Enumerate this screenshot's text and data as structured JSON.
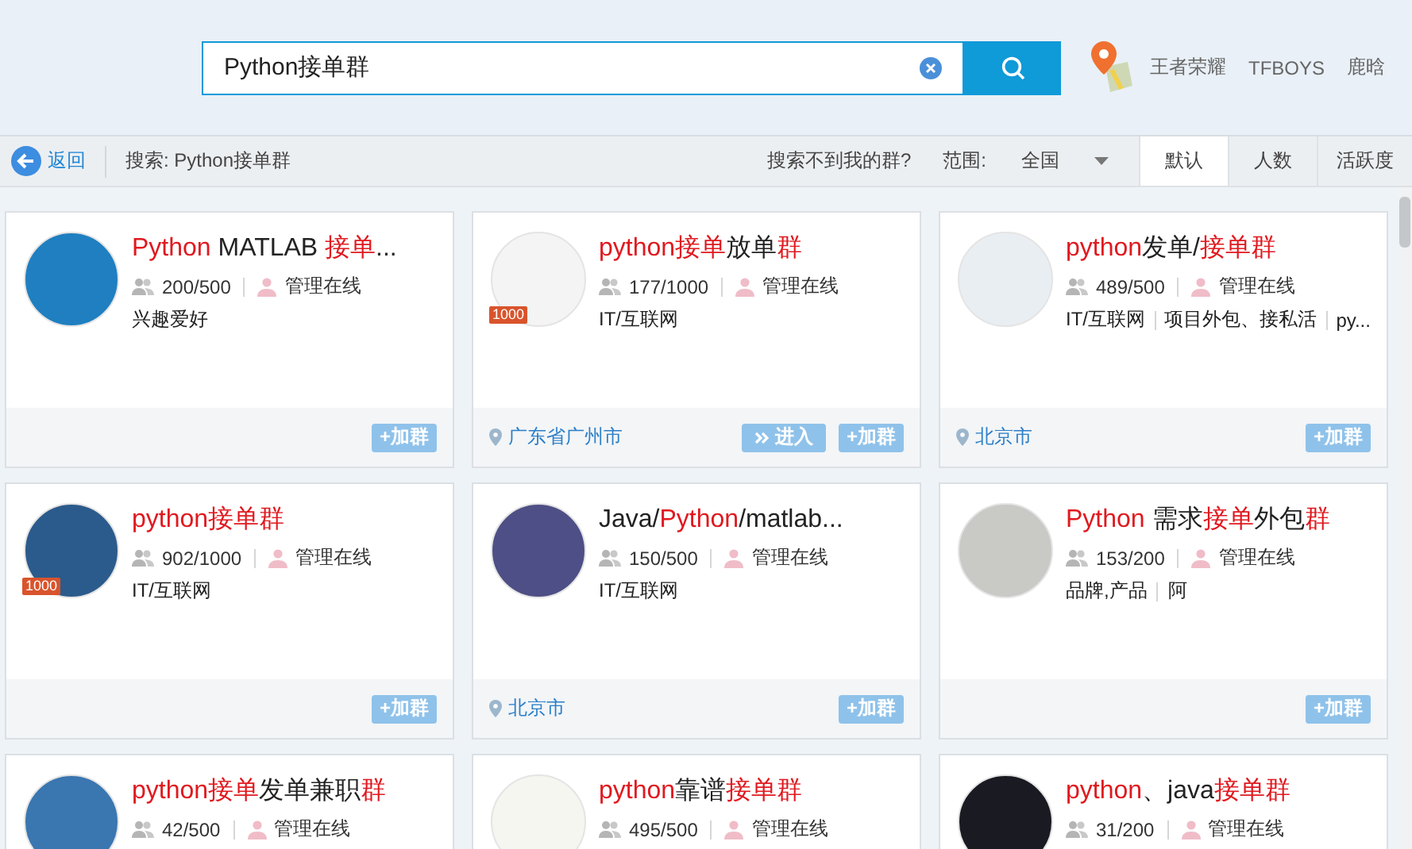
{
  "search": {
    "value": "Python接单群"
  },
  "top_links": [
    "王者荣耀",
    "TFBOYS",
    "鹿晗"
  ],
  "toolbar": {
    "back": "返回",
    "query": "搜索: Python接单群",
    "help": "搜索不到我的群?",
    "range_label": "范围:",
    "range_value": "全国",
    "sort_tabs": [
      {
        "label": "默认",
        "selected": true
      },
      {
        "label": "人数",
        "selected": false
      },
      {
        "label": "活跃度",
        "selected": false
      }
    ]
  },
  "groups": [
    {
      "title": [
        {
          "text": "Python",
          "highlight": true
        },
        {
          "text": " MATLAB ",
          "highlight": false
        },
        {
          "text": "接单",
          "highlight": true
        },
        {
          "text": "...",
          "highlight": false
        }
      ],
      "avatar": {
        "color": "#1f7fc0"
      },
      "members": "200/500",
      "admin": "管理在线",
      "tags": [
        "兴趣爱好"
      ],
      "buttons": [
        {
          "kind": "join",
          "label": "+加群"
        }
      ]
    },
    {
      "title": [
        {
          "text": "python接单",
          "highlight": true
        },
        {
          "text": "放单",
          "highlight": false
        },
        {
          "text": "群",
          "highlight": true
        }
      ],
      "avatar": {
        "color": "#f4f4f4",
        "badge": "1000"
      },
      "members": "177/1000",
      "admin": "管理在线",
      "tags": [
        "IT/互联网"
      ],
      "location": "广东省广州市",
      "buttons": [
        {
          "kind": "enter",
          "label": "进入"
        },
        {
          "kind": "join",
          "label": "+加群"
        }
      ]
    },
    {
      "title": [
        {
          "text": "python",
          "highlight": true
        },
        {
          "text": "发单/",
          "highlight": false
        },
        {
          "text": "接单群",
          "highlight": true
        }
      ],
      "avatar": {
        "color": "#e9eef3"
      },
      "members": "489/500",
      "admin": "管理在线",
      "tags": [
        "IT/互联网",
        "项目外包、接私活",
        "py..."
      ],
      "location": "北京市",
      "buttons": [
        {
          "kind": "join",
          "label": "+加群"
        }
      ]
    },
    {
      "title": [
        {
          "text": "python接单群",
          "highlight": true
        }
      ],
      "avatar": {
        "color": "#2b5b8c",
        "badge": "1000"
      },
      "members": "902/1000",
      "admin": "管理在线",
      "tags": [
        "IT/互联网"
      ],
      "buttons": [
        {
          "kind": "join",
          "label": "+加群"
        }
      ]
    },
    {
      "title": [
        {
          "text": "Java/",
          "highlight": false
        },
        {
          "text": "Python",
          "highlight": true
        },
        {
          "text": "/matlab...",
          "highlight": false
        }
      ],
      "avatar": {
        "color": "#4e4f86"
      },
      "members": "150/500",
      "admin": "管理在线",
      "tags": [
        "IT/互联网"
      ],
      "location": "北京市",
      "buttons": [
        {
          "kind": "join",
          "label": "+加群"
        }
      ]
    },
    {
      "title": [
        {
          "text": "Python",
          "highlight": true
        },
        {
          "text": " 需求",
          "highlight": false
        },
        {
          "text": "接单",
          "highlight": true
        },
        {
          "text": "外包",
          "highlight": false
        },
        {
          "text": "群",
          "highlight": true
        }
      ],
      "avatar": {
        "color": "#c9cac6"
      },
      "members": "153/200",
      "admin": "管理在线",
      "tags": [
        "品牌,产品",
        "阿"
      ],
      "buttons": [
        {
          "kind": "join",
          "label": "+加群"
        }
      ]
    },
    {
      "title": [
        {
          "text": "python接单",
          "highlight": true
        },
        {
          "text": "发单兼职",
          "highlight": false
        },
        {
          "text": "群",
          "highlight": true
        }
      ],
      "avatar": {
        "color": "#3a76b0"
      },
      "members": "42/500",
      "admin": "管理在线"
    },
    {
      "title": [
        {
          "text": "python",
          "highlight": true
        },
        {
          "text": "靠谱",
          "highlight": false
        },
        {
          "text": "接单群",
          "highlight": true
        }
      ],
      "avatar": {
        "color": "#f6f6f0"
      },
      "members": "495/500",
      "admin": "管理在线"
    },
    {
      "title": [
        {
          "text": "python",
          "highlight": true
        },
        {
          "text": "、java",
          "highlight": false
        },
        {
          "text": "接单群",
          "highlight": true
        }
      ],
      "avatar": {
        "color": "#1a1a22"
      },
      "members": "31/200",
      "admin": "管理在线"
    }
  ]
}
